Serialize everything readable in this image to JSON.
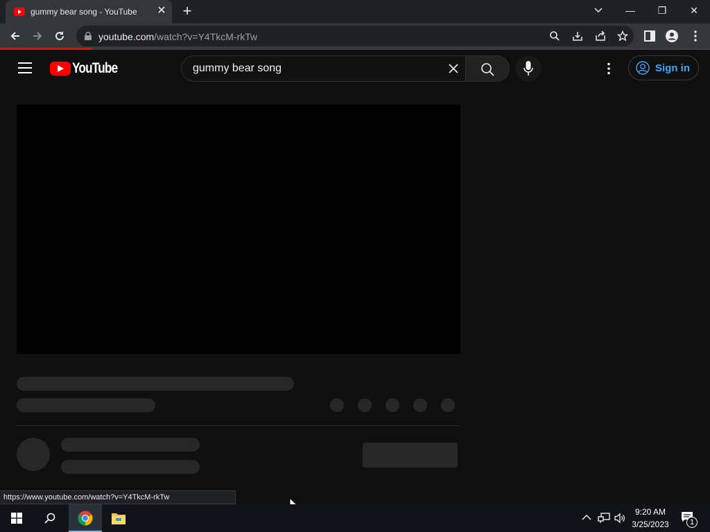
{
  "browser": {
    "tab": {
      "title": "gummy bear song - YouTube",
      "close": "✕"
    },
    "new_tab": "+",
    "window_controls": {
      "minimize": "—",
      "restore": "❐",
      "close": "✕"
    },
    "address": {
      "host": "youtube.com",
      "path": "/watch?v=Y4TkcM-rkTw"
    },
    "status_url": "https://www.youtube.com/watch?v=Y4TkcM-rkTw",
    "progress_fraction": 0.13
  },
  "youtube": {
    "logo_text": "YouTube",
    "search": {
      "query": "gummy bear song"
    },
    "sign_in": "Sign in",
    "brand_color": "#ff0000",
    "link_color": "#3ea6ff"
  },
  "taskbar": {
    "time": "9:20 AM",
    "date": "3/25/2023",
    "notification_count": "1"
  }
}
